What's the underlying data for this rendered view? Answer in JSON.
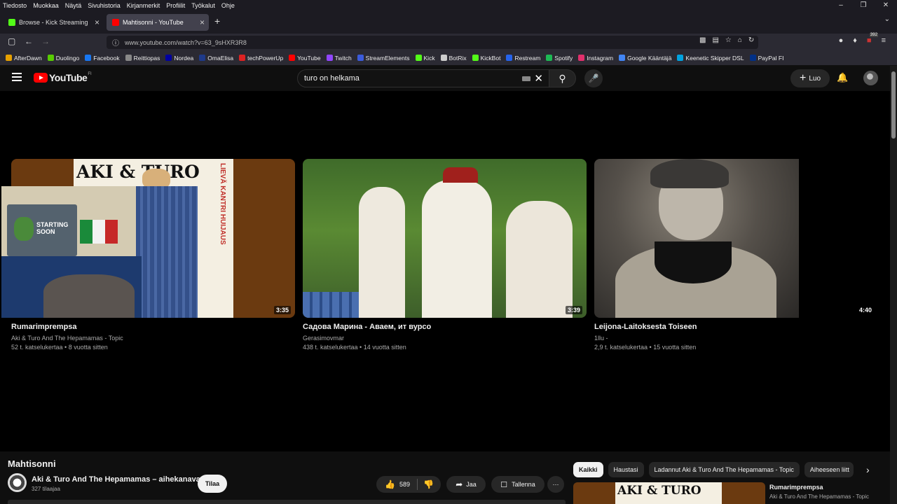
{
  "menubar": [
    "Tiedosto",
    "Muokkaa",
    "Näytä",
    "Sivuhistoria",
    "Kirjanmerkit",
    "Profiilit",
    "Työkalut",
    "Ohje"
  ],
  "tabs": [
    {
      "label": "Browse - Kick Streaming",
      "color": "#53fc18"
    },
    {
      "label": "Mahtisonni - YouTube",
      "color": "#ff0000"
    }
  ],
  "url": "www.youtube.com/watch?v=63_9sHXR3R8",
  "extension_badge": "392",
  "bookmarks": [
    {
      "label": "AfterDawn",
      "color": "#e6a000"
    },
    {
      "label": "Duolingo",
      "color": "#58cc02"
    },
    {
      "label": "Facebook",
      "color": "#1877f2"
    },
    {
      "label": "Reittiopas",
      "color": "#888888"
    },
    {
      "label": "Nordea",
      "color": "#0000a0"
    },
    {
      "label": "OmaElisa",
      "color": "#1e3a8a"
    },
    {
      "label": "techPowerUp",
      "color": "#d22"
    },
    {
      "label": "YouTube",
      "color": "#ff0000"
    },
    {
      "label": "Twitch",
      "color": "#9146ff"
    },
    {
      "label": "StreamElements",
      "color": "#3b5bdb"
    },
    {
      "label": "Kick",
      "color": "#53fc18"
    },
    {
      "label": "BotRix",
      "color": "#cccccc"
    },
    {
      "label": "KickBot",
      "color": "#53fc18"
    },
    {
      "label": "Restream",
      "color": "#2563eb"
    },
    {
      "label": "Spotify",
      "color": "#1db954"
    },
    {
      "label": "Instagram",
      "color": "#e1306c"
    },
    {
      "label": "Google Kääntäjä",
      "color": "#4285f4"
    },
    {
      "label": "Keenetic Skipper DSL",
      "color": "#00a3e0"
    },
    {
      "label": "PayPal FI",
      "color": "#003087"
    }
  ],
  "youtube": {
    "logo_text": "YouTube",
    "region": "FI",
    "search_value": "turo on helkama",
    "create_label": "Luo"
  },
  "videos": [
    {
      "title": "Rumarimprempsa",
      "channel": "Aki & Turo And The Hepamamas - Topic",
      "meta": "52 t. katselukertaa • 8 vuotta sitten",
      "duration": "3:35"
    },
    {
      "title": "Садова Марина - Аваем, ит вурсо",
      "channel": "Gerasimovmar",
      "meta": "438 t. katselukertaa • 14 vuotta sitten",
      "duration": "3:39"
    },
    {
      "title": "Leijona-Laitoksesta Toiseen",
      "channel": "1llu -",
      "meta": "2,9 t. katselukertaa • 15 vuotta sitten",
      "duration": "4:40"
    }
  ],
  "thumb_text": {
    "aki_turo": "AKI & TURO",
    "side": "LIEVÄ KANTRI HUIJAUS",
    "starting": "STARTING SOON"
  },
  "current": {
    "title": "Mahtisonni",
    "channel": "Aki & Turo And The Hepamamas – aihekanava",
    "subscribers": "327 tilaajaa",
    "subscribe": "Tilaa",
    "likes": "589",
    "share": "Jaa",
    "save": "Tallenna"
  },
  "chips": [
    "Kaikki",
    "Haustasi",
    "Ladannut Aki & Turo And The Hepamamas - Topic",
    "Aiheeseen liitt"
  ],
  "related": {
    "title": "Rumarimprempsa",
    "channel": "Aki & Turo And The Hepamamas - Topic"
  }
}
